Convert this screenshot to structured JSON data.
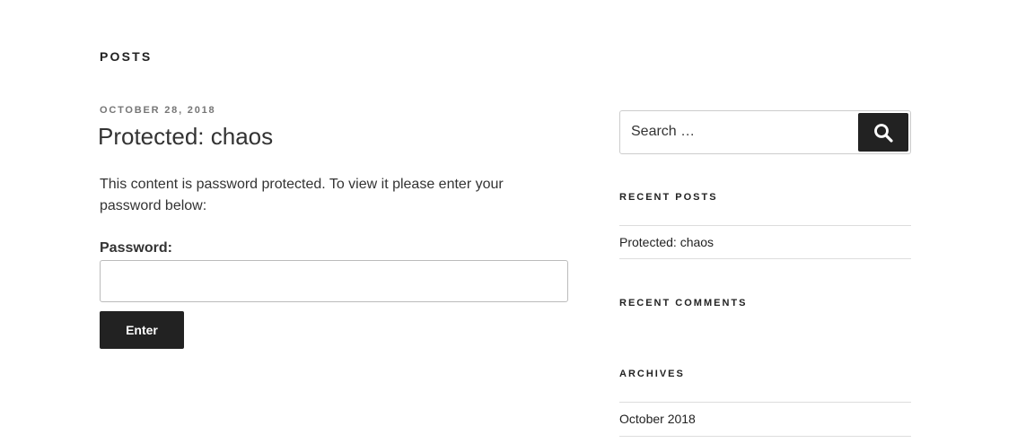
{
  "page": {
    "heading": "Posts"
  },
  "post": {
    "date": "October 28, 2018",
    "title": "Protected: chaos",
    "body": "This content is password protected. To view it please enter your password below:",
    "password_label": "Password:",
    "password_value": "",
    "enter_label": "Enter"
  },
  "sidebar": {
    "search": {
      "placeholder": "Search …",
      "button_icon": "search-icon"
    },
    "recent_posts": {
      "title": "Recent Posts",
      "items": [
        {
          "label": "Protected: chaos"
        }
      ]
    },
    "recent_comments": {
      "title": "Recent Comments"
    },
    "archives": {
      "title": "Archives",
      "items": [
        {
          "label": "October 2018"
        }
      ]
    }
  },
  "colors": {
    "text": "#333333",
    "dark": "#222222",
    "muted": "#767676",
    "border": "#dddddd"
  }
}
